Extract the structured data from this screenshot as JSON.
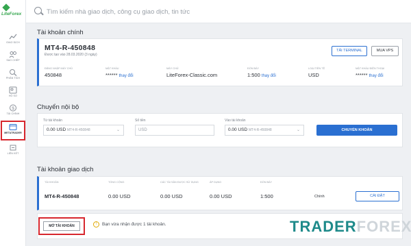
{
  "brand": {
    "logo_text": "LiteForex"
  },
  "search": {
    "placeholder": "Tìm kiếm nhà giao dịch, công cụ giao dịch, tin tức"
  },
  "sidebar": {
    "items": [
      {
        "label": "GIAO DỊCH",
        "icon": "trading-chart-icon"
      },
      {
        "label": "SAO CHÉP",
        "icon": "copy-people-icon"
      },
      {
        "label": "PHÂN TÍCH",
        "icon": "analytics-icon"
      },
      {
        "label": "HỒ SƠ",
        "icon": "profile-icon"
      },
      {
        "label": "TÀI CHÍNH",
        "icon": "finance-dollar-icon"
      },
      {
        "label": "METATRADER",
        "icon": "metatrader-window-icon"
      },
      {
        "label": "LIÊN KẾT",
        "icon": "affiliate-link-icon"
      }
    ]
  },
  "main_account": {
    "section_title": "Tài khoản chính",
    "name": "MT4-R-450848",
    "created": "Được tạo vào 28.03.2020 (3 ngày)",
    "buttons": {
      "terminal": "TẢI TERMINAL",
      "vps": "MUA VPS"
    },
    "fields": [
      {
        "label": "Đăng nhập máy chủ",
        "value": "450848"
      },
      {
        "label": "Mật khẩu",
        "value": "******",
        "link": "thay đổi"
      },
      {
        "label": "Máy chủ",
        "value": "LiteForex-Classic.com"
      },
      {
        "label": "Đòn bẩy",
        "value": "1:500",
        "link": "thay đổi"
      },
      {
        "label": "Loại tiền tệ",
        "value": "USD"
      },
      {
        "label": "Mật khẩu điện thoại",
        "value": "******",
        "link": "thay đổi"
      }
    ]
  },
  "transfer": {
    "section_title": "Chuyển nội bộ",
    "from_label": "Từ tài khoản",
    "from_value": "0.00 USD",
    "from_account": "MT4-R-450848",
    "amount_label": "Số tiền",
    "amount_placeholder": "USD",
    "to_label": "Vào tài khoản",
    "to_value": "0.00 USD",
    "to_account": "MT4-R-450848",
    "submit": "CHUYỂN KHOẢN"
  },
  "trading_accounts": {
    "section_title": "Tài khoản giao dịch",
    "columns": [
      "Tài khoản",
      "Tổng cộng",
      "Các tài sản được sử dụng",
      "Áp dụng",
      "Đòn bẩy"
    ],
    "rows": [
      {
        "account": "MT4-R-450848",
        "total": "0.00 USD",
        "used": "0.00 USD",
        "available": "0.00 USD",
        "leverage": "1:500",
        "type": "Chính",
        "action": "CÀI ĐẶT"
      }
    ],
    "open_button": "MỞ TÀI KHOẢN",
    "notice": "Bạn vừa nhận được 1 tài khoản."
  },
  "watermark": {
    "part_a": "TRADER",
    "part_b": "FOREX"
  },
  "colors": {
    "accent": "#2a6fd1",
    "brand_green": "#36a64f",
    "highlight_red": "#d7262d"
  }
}
